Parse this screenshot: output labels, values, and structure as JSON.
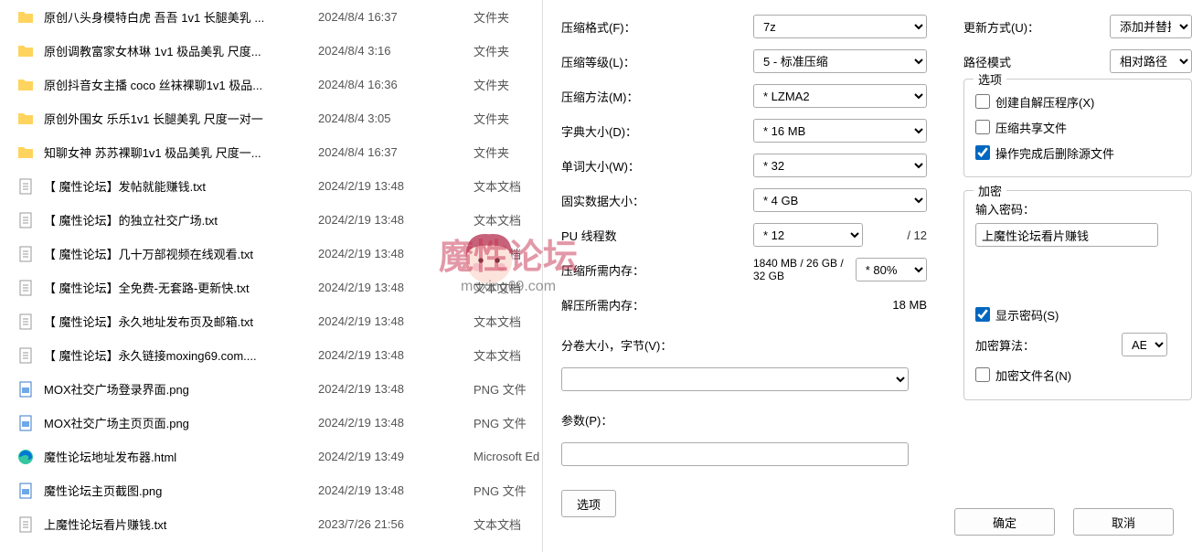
{
  "files": [
    {
      "name": "原创八头身模特白虎 吾吾 1v1 长腿美乳 ...",
      "date": "2024/8/4 16:37",
      "type": "文件夹",
      "icon": "folder"
    },
    {
      "name": "原创调教富家女林琳 1v1 极品美乳 尺度...",
      "date": "2024/8/4 3:16",
      "type": "文件夹",
      "icon": "folder"
    },
    {
      "name": "原创抖音女主播 coco 丝袜裸聊1v1 极品...",
      "date": "2024/8/4 16:36",
      "type": "文件夹",
      "icon": "folder"
    },
    {
      "name": "原创外围女 乐乐1v1 长腿美乳 尺度一对一",
      "date": "2024/8/4 3:05",
      "type": "文件夹",
      "icon": "folder"
    },
    {
      "name": "知聊女神 苏苏裸聊1v1 极品美乳 尺度一...",
      "date": "2024/8/4 16:37",
      "type": "文件夹",
      "icon": "folder"
    },
    {
      "name": "【 魔性论坛】发帖就能赚钱.txt",
      "date": "2024/2/19 13:48",
      "type": "文本文档",
      "icon": "txt"
    },
    {
      "name": "【 魔性论坛】的独立社交广场.txt",
      "date": "2024/2/19 13:48",
      "type": "文本文档",
      "icon": "txt"
    },
    {
      "name": "【 魔性论坛】几十万部视频在线观看.txt",
      "date": "2024/2/19 13:48",
      "type": "文本文档",
      "icon": "txt"
    },
    {
      "name": "【 魔性论坛】全免费-无套路-更新快.txt",
      "date": "2024/2/19 13:48",
      "type": "文本文档",
      "icon": "txt"
    },
    {
      "name": "【 魔性论坛】永久地址发布页及邮箱.txt",
      "date": "2024/2/19 13:48",
      "type": "文本文档",
      "icon": "txt"
    },
    {
      "name": "【 魔性论坛】永久链接moxing69.com....",
      "date": "2024/2/19 13:48",
      "type": "文本文档",
      "icon": "txt"
    },
    {
      "name": "MOX社交广场登录界面.png",
      "date": "2024/2/19 13:48",
      "type": "PNG 文件",
      "icon": "png"
    },
    {
      "name": "MOX社交广场主页页面.png",
      "date": "2024/2/19 13:48",
      "type": "PNG 文件",
      "icon": "png"
    },
    {
      "name": "魔性论坛地址发布器.html",
      "date": "2024/2/19 13:49",
      "type": "Microsoft Ed",
      "icon": "edge"
    },
    {
      "name": "魔性论坛主页截图.png",
      "date": "2024/2/19 13:48",
      "type": "PNG 文件",
      "icon": "png"
    },
    {
      "name": "上魔性论坛看片赚钱.txt",
      "date": "2023/7/26 21:56",
      "type": "文本文档",
      "icon": "txt"
    }
  ],
  "labels": {
    "format": "压缩格式(F)：",
    "level": "压缩等级(L)：",
    "method": "压缩方法(M)：",
    "dict": "字典大小(D)：",
    "word": "单词大小(W)：",
    "solid": "固实数据大小：",
    "threads": "PU 线程数",
    "memc": "压缩所需内存：",
    "memd": "解压所需内存：",
    "split": "分卷大小，字节(V)：",
    "params": "参数(P)：",
    "options_btn": "选项",
    "update": "更新方式(U)：",
    "pathmode": "路径模式",
    "options": "选项",
    "sfx": "创建自解压程序(X)",
    "share": "压缩共享文件",
    "delete": "操作完成后删除源文件",
    "encryption": "加密",
    "enterpw": "输入密码：",
    "showpw": "显示密码(S)",
    "algo": "加密算法：",
    "encnames": "加密文件名(N)",
    "ok": "确定",
    "cancel": "取消"
  },
  "values": {
    "format": "7z",
    "level": "5 - 标准压缩",
    "method": "* LZMA2",
    "dict": "* 16 MB",
    "word": "* 32",
    "solid": "* 4 GB",
    "threads": "* 12",
    "threads_max": "/ 12",
    "memc_val": "1840 MB / 26 GB / 32 GB",
    "memc_pct": "* 80%",
    "memd": "18 MB",
    "update": "添加并替换",
    "pathmode": "相对路径",
    "password": "上魔性论坛看片赚钱",
    "algo": "AES"
  },
  "watermark": {
    "title": "魔性论坛",
    "sub": "moxing69.com"
  }
}
